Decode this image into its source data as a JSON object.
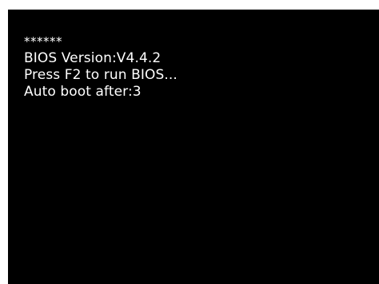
{
  "boot_screen": {
    "lines": [
      "******",
      "BIOS Version:V4.4.2",
      "Press F2 to run BIOS...",
      "Auto boot after:3"
    ]
  },
  "colors": {
    "screen_background": "#000000",
    "text": "#ffffff",
    "bezel": "#ffffff"
  }
}
